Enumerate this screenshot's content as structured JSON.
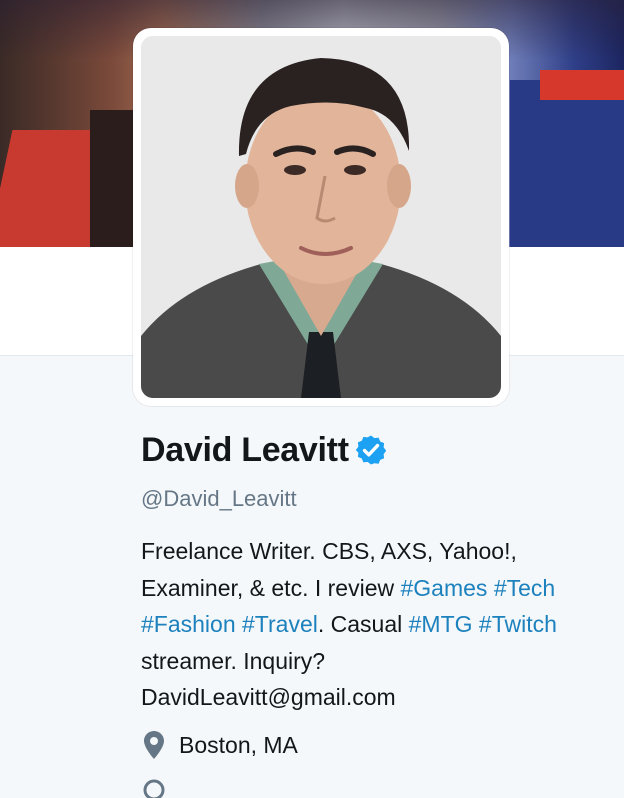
{
  "profile": {
    "name": "David Leavitt",
    "handle": "@David_Leavitt",
    "bio": {
      "line1": "Freelance Writer. CBS, AXS, Yahoo!,",
      "line2_text": "Examiner, & etc. I review ",
      "tag_games": "#Games",
      "tag_tech": "#Tech",
      "tag_fashion": "#Fashion",
      "tag_travel": "#Travel",
      "line3_text": ". Casual ",
      "tag_mtg": "#MTG",
      "tag_twitch": "#Twitch",
      "line4": "streamer. Inquiry?",
      "line5": "DavidLeavitt@gmail.com"
    },
    "location": "Boston, MA"
  },
  "icons": {
    "verified": "verified-badge-icon",
    "location": "location-pin-icon"
  },
  "colors": {
    "accent": "#1c81bd",
    "verified": "#1da1f2",
    "muted": "#657786"
  }
}
